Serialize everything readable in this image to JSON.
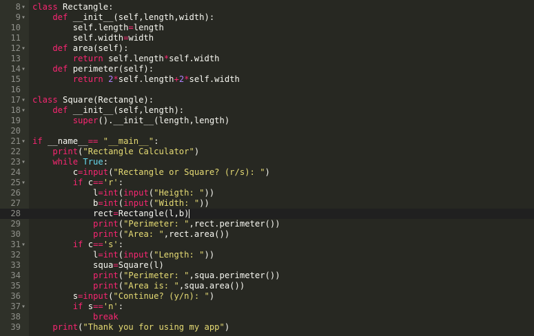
{
  "editor": {
    "theme": {
      "background": "#272822",
      "keyword": "#f92672",
      "string": "#e6db74",
      "builtin": "#66d9ef",
      "number": "#ae81ff",
      "text": "#f8f8f2",
      "gutter_text": "#8f908a"
    },
    "lines": [
      {
        "num": "8",
        "fold": true,
        "tokens": [
          {
            "t": "class ",
            "c": "k"
          },
          {
            "t": "Rectangle:",
            "c": "p"
          }
        ]
      },
      {
        "num": "9",
        "fold": true,
        "tokens": [
          {
            "t": "    def ",
            "c": "k"
          },
          {
            "t": "__init__(self,length,width):",
            "c": "p"
          }
        ]
      },
      {
        "num": "10",
        "fold": false,
        "tokens": [
          {
            "t": "        self.length",
            "c": "p"
          },
          {
            "t": "=",
            "c": "o"
          },
          {
            "t": "length",
            "c": "p"
          }
        ]
      },
      {
        "num": "11",
        "fold": false,
        "tokens": [
          {
            "t": "        self.width",
            "c": "p"
          },
          {
            "t": "=",
            "c": "o"
          },
          {
            "t": "width",
            "c": "p"
          }
        ]
      },
      {
        "num": "12",
        "fold": true,
        "tokens": [
          {
            "t": "    def ",
            "c": "k"
          },
          {
            "t": "area(self):",
            "c": "p"
          }
        ]
      },
      {
        "num": "13",
        "fold": false,
        "tokens": [
          {
            "t": "        return ",
            "c": "k"
          },
          {
            "t": "self.length",
            "c": "p"
          },
          {
            "t": "*",
            "c": "o"
          },
          {
            "t": "self.width",
            "c": "p"
          }
        ]
      },
      {
        "num": "14",
        "fold": true,
        "tokens": [
          {
            "t": "    def ",
            "c": "k"
          },
          {
            "t": "perimeter(self):",
            "c": "p"
          }
        ]
      },
      {
        "num": "15",
        "fold": false,
        "tokens": [
          {
            "t": "        return ",
            "c": "k"
          },
          {
            "t": "2",
            "c": "n"
          },
          {
            "t": "*",
            "c": "o"
          },
          {
            "t": "self.length",
            "c": "p"
          },
          {
            "t": "+",
            "c": "o"
          },
          {
            "t": "2",
            "c": "n"
          },
          {
            "t": "*",
            "c": "o"
          },
          {
            "t": "self.width",
            "c": "p"
          }
        ]
      },
      {
        "num": "16",
        "fold": false,
        "tokens": []
      },
      {
        "num": "17",
        "fold": true,
        "tokens": [
          {
            "t": "class ",
            "c": "k"
          },
          {
            "t": "Square(Rectangle):",
            "c": "p"
          }
        ]
      },
      {
        "num": "18",
        "fold": true,
        "tokens": [
          {
            "t": "    def ",
            "c": "k"
          },
          {
            "t": "__init__(self,length):",
            "c": "p"
          }
        ]
      },
      {
        "num": "19",
        "fold": false,
        "tokens": [
          {
            "t": "        ",
            "c": "p"
          },
          {
            "t": "super",
            "c": "k"
          },
          {
            "t": "().__init__(length,length)",
            "c": "p"
          }
        ]
      },
      {
        "num": "20",
        "fold": false,
        "tokens": []
      },
      {
        "num": "21",
        "fold": true,
        "tokens": [
          {
            "t": "if ",
            "c": "k"
          },
          {
            "t": "__name__",
            "c": "p"
          },
          {
            "t": "== ",
            "c": "o"
          },
          {
            "t": "\"__main__\"",
            "c": "s"
          },
          {
            "t": ":",
            "c": "p"
          }
        ]
      },
      {
        "num": "22",
        "fold": false,
        "tokens": [
          {
            "t": "    ",
            "c": "p"
          },
          {
            "t": "print",
            "c": "k"
          },
          {
            "t": "(",
            "c": "p"
          },
          {
            "t": "\"Rectangle Calculator\"",
            "c": "s"
          },
          {
            "t": ")",
            "c": "p"
          }
        ]
      },
      {
        "num": "23",
        "fold": true,
        "tokens": [
          {
            "t": "    while ",
            "c": "k"
          },
          {
            "t": "True",
            "c": "b"
          },
          {
            "t": ":",
            "c": "p"
          }
        ]
      },
      {
        "num": "24",
        "fold": false,
        "tokens": [
          {
            "t": "        c",
            "c": "p"
          },
          {
            "t": "=",
            "c": "o"
          },
          {
            "t": "input",
            "c": "k"
          },
          {
            "t": "(",
            "c": "p"
          },
          {
            "t": "\"Rectangle or Square? (r/s): \"",
            "c": "s"
          },
          {
            "t": ")",
            "c": "p"
          }
        ]
      },
      {
        "num": "25",
        "fold": true,
        "tokens": [
          {
            "t": "        if ",
            "c": "k"
          },
          {
            "t": "c",
            "c": "p"
          },
          {
            "t": "==",
            "c": "o"
          },
          {
            "t": "'r'",
            "c": "s"
          },
          {
            "t": ":",
            "c": "p"
          }
        ]
      },
      {
        "num": "26",
        "fold": false,
        "tokens": [
          {
            "t": "            l",
            "c": "p"
          },
          {
            "t": "=",
            "c": "o"
          },
          {
            "t": "int",
            "c": "k"
          },
          {
            "t": "(",
            "c": "p"
          },
          {
            "t": "input",
            "c": "k"
          },
          {
            "t": "(",
            "c": "p"
          },
          {
            "t": "\"Heigth: \"",
            "c": "s"
          },
          {
            "t": "))",
            "c": "p"
          }
        ]
      },
      {
        "num": "27",
        "fold": false,
        "tokens": [
          {
            "t": "            b",
            "c": "p"
          },
          {
            "t": "=",
            "c": "o"
          },
          {
            "t": "int",
            "c": "k"
          },
          {
            "t": "(",
            "c": "p"
          },
          {
            "t": "input",
            "c": "k"
          },
          {
            "t": "(",
            "c": "p"
          },
          {
            "t": "\"Width: \"",
            "c": "s"
          },
          {
            "t": "))",
            "c": "p"
          }
        ]
      },
      {
        "num": "28",
        "fold": false,
        "active": true,
        "tokens": [
          {
            "t": "            rect",
            "c": "p"
          },
          {
            "t": "=",
            "c": "o"
          },
          {
            "t": "Rectangle(l,b)",
            "c": "p"
          }
        ]
      },
      {
        "num": "29",
        "fold": false,
        "tokens": [
          {
            "t": "            ",
            "c": "p"
          },
          {
            "t": "print",
            "c": "k"
          },
          {
            "t": "(",
            "c": "p"
          },
          {
            "t": "\"Perimeter: \"",
            "c": "s"
          },
          {
            "t": ",rect.perimeter())",
            "c": "p"
          }
        ]
      },
      {
        "num": "30",
        "fold": false,
        "tokens": [
          {
            "t": "            ",
            "c": "p"
          },
          {
            "t": "print",
            "c": "k"
          },
          {
            "t": "(",
            "c": "p"
          },
          {
            "t": "\"Area: \"",
            "c": "s"
          },
          {
            "t": ",rect.area())",
            "c": "p"
          }
        ]
      },
      {
        "num": "31",
        "fold": true,
        "tokens": [
          {
            "t": "        if ",
            "c": "k"
          },
          {
            "t": "c",
            "c": "p"
          },
          {
            "t": "==",
            "c": "o"
          },
          {
            "t": "'s'",
            "c": "s"
          },
          {
            "t": ":",
            "c": "p"
          }
        ]
      },
      {
        "num": "32",
        "fold": false,
        "tokens": [
          {
            "t": "            l",
            "c": "p"
          },
          {
            "t": "=",
            "c": "o"
          },
          {
            "t": "int",
            "c": "k"
          },
          {
            "t": "(",
            "c": "p"
          },
          {
            "t": "input",
            "c": "k"
          },
          {
            "t": "(",
            "c": "p"
          },
          {
            "t": "\"Length: \"",
            "c": "s"
          },
          {
            "t": "))",
            "c": "p"
          }
        ]
      },
      {
        "num": "33",
        "fold": false,
        "tokens": [
          {
            "t": "            squa",
            "c": "p"
          },
          {
            "t": "=",
            "c": "o"
          },
          {
            "t": "Square(l)",
            "c": "p"
          }
        ]
      },
      {
        "num": "34",
        "fold": false,
        "tokens": [
          {
            "t": "            ",
            "c": "p"
          },
          {
            "t": "print",
            "c": "k"
          },
          {
            "t": "(",
            "c": "p"
          },
          {
            "t": "\"Perimeter: \"",
            "c": "s"
          },
          {
            "t": ",squa.perimeter())",
            "c": "p"
          }
        ]
      },
      {
        "num": "35",
        "fold": false,
        "tokens": [
          {
            "t": "            ",
            "c": "p"
          },
          {
            "t": "print",
            "c": "k"
          },
          {
            "t": "(",
            "c": "p"
          },
          {
            "t": "\"Area is: \"",
            "c": "s"
          },
          {
            "t": ",squa.area())",
            "c": "p"
          }
        ]
      },
      {
        "num": "36",
        "fold": false,
        "tokens": [
          {
            "t": "        s",
            "c": "p"
          },
          {
            "t": "=",
            "c": "o"
          },
          {
            "t": "input",
            "c": "k"
          },
          {
            "t": "(",
            "c": "p"
          },
          {
            "t": "\"Continue? (y/n): \"",
            "c": "s"
          },
          {
            "t": ")",
            "c": "p"
          }
        ]
      },
      {
        "num": "37",
        "fold": true,
        "tokens": [
          {
            "t": "        if ",
            "c": "k"
          },
          {
            "t": "s",
            "c": "p"
          },
          {
            "t": "==",
            "c": "o"
          },
          {
            "t": "'n'",
            "c": "s"
          },
          {
            "t": ":",
            "c": "p"
          }
        ]
      },
      {
        "num": "38",
        "fold": false,
        "tokens": [
          {
            "t": "            break",
            "c": "k"
          }
        ]
      },
      {
        "num": "39",
        "fold": false,
        "tokens": [
          {
            "t": "    ",
            "c": "p"
          },
          {
            "t": "print",
            "c": "k"
          },
          {
            "t": "(",
            "c": "p"
          },
          {
            "t": "\"Thank you for using my app\"",
            "c": "s"
          },
          {
            "t": ")",
            "c": "p"
          }
        ]
      }
    ]
  }
}
